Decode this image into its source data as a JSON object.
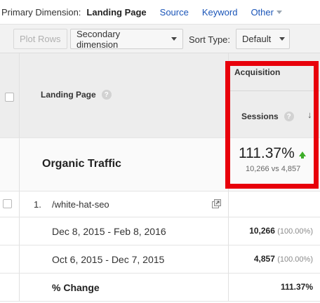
{
  "primary_dimension": {
    "label": "Primary Dimension:",
    "active": "Landing Page",
    "links": [
      "Source",
      "Keyword"
    ],
    "other": "Other"
  },
  "toolbar": {
    "plot_rows": "Plot Rows",
    "secondary_dimension": "Secondary dimension",
    "sort_type_label": "Sort Type:",
    "sort_type_value": "Default"
  },
  "table": {
    "header": {
      "landing_page": "Landing Page",
      "group": "Acquisition",
      "metric": "Sessions",
      "help_glyph": "?",
      "sort_glyph": "↓"
    },
    "summary": {
      "label": "Organic Traffic",
      "change_pct": "111.37%",
      "comparison": "10,266 vs 4,857"
    },
    "rows": [
      {
        "index": "1.",
        "page": "/white-hat-seo",
        "periods": [
          {
            "range": "Dec 8, 2015 - Feb 8, 2016",
            "value": "10,266",
            "pct": "(100.00%)"
          },
          {
            "range": "Oct 6, 2015 - Dec 7, 2015",
            "value": "4,857",
            "pct": "(100.00%)"
          }
        ],
        "change_label": "% Change",
        "change_value": "111.37%"
      }
    ]
  },
  "colors": {
    "highlight": "#e8000b",
    "link": "#1a55b8",
    "up_arrow": "#3fae2a"
  }
}
